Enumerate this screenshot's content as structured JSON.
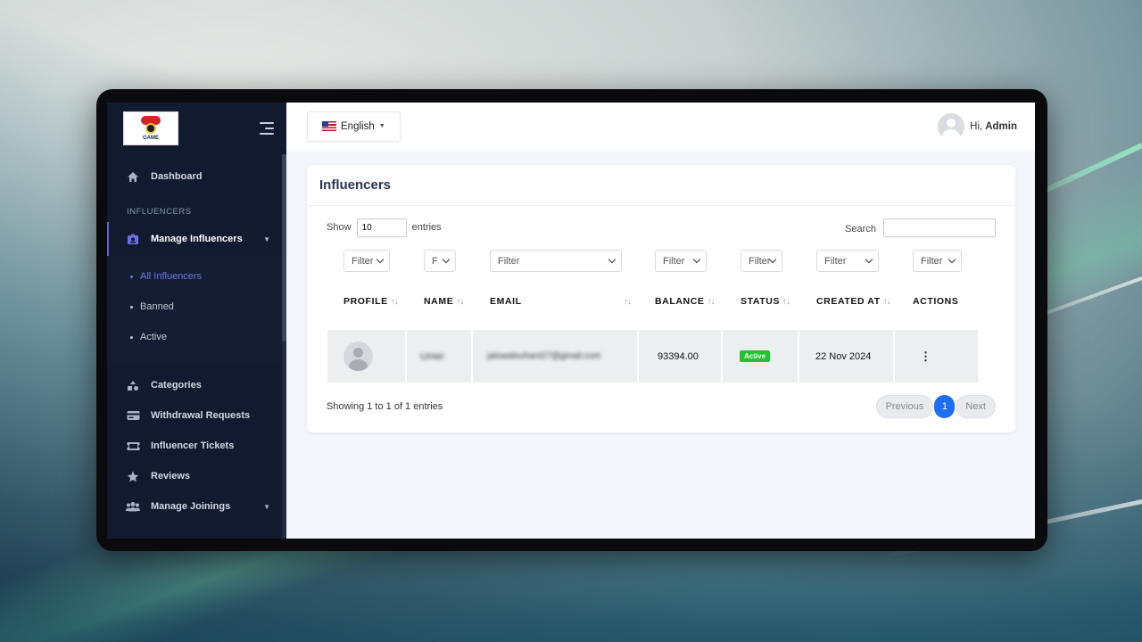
{
  "header": {
    "language_label": "English",
    "greeting": "Hi,",
    "user_name": "Admin"
  },
  "logo": {
    "text": "GAME"
  },
  "sidebar": {
    "dashboard": "Dashboard",
    "section_label": "INFLUENCERS",
    "manage_influencers": "Manage Influencers",
    "sub_items": [
      {
        "label": "All Influencers",
        "selected": true
      },
      {
        "label": "Banned",
        "selected": false
      },
      {
        "label": "Active",
        "selected": false
      }
    ],
    "items": [
      {
        "label": "Categories",
        "icon": "shapes-icon"
      },
      {
        "label": "Withdrawal Requests",
        "icon": "card-icon"
      },
      {
        "label": "Influencer Tickets",
        "icon": "ticket-icon"
      },
      {
        "label": "Reviews",
        "icon": "star-icon"
      },
      {
        "label": "Manage Joinings",
        "icon": "users-icon"
      }
    ]
  },
  "page": {
    "title": "Influencers",
    "show_label": "Show",
    "entries_value": "10",
    "entries_label": "entries",
    "search_label": "Search",
    "filters": [
      "Filter",
      "F",
      "Filter",
      "Filter",
      "Filter",
      "Filter",
      "Filter"
    ],
    "columns": [
      "PROFILE",
      "NAME",
      "EMAIL",
      "BALANCE",
      "STATUS",
      "CREATED AT",
      "ACTIONS"
    ],
    "sort_glyph": "↑↓",
    "rows": [
      {
        "name": "Umer",
        "email": "jatowalsuhani27@gmail.com",
        "balance": "93394.00",
        "status": "Active",
        "created_at": "22 Nov 2024",
        "actions": "⋮"
      }
    ],
    "summary": "Showing 1 to 1 of 1 entries",
    "pagination": {
      "previous": "Previous",
      "current": "1",
      "next": "Next"
    }
  },
  "colors": {
    "sidebar_bg": "#111a2e",
    "accent": "#6d78e8",
    "active_badge": "#1fc42f",
    "page_button": "#1d6ef2"
  }
}
